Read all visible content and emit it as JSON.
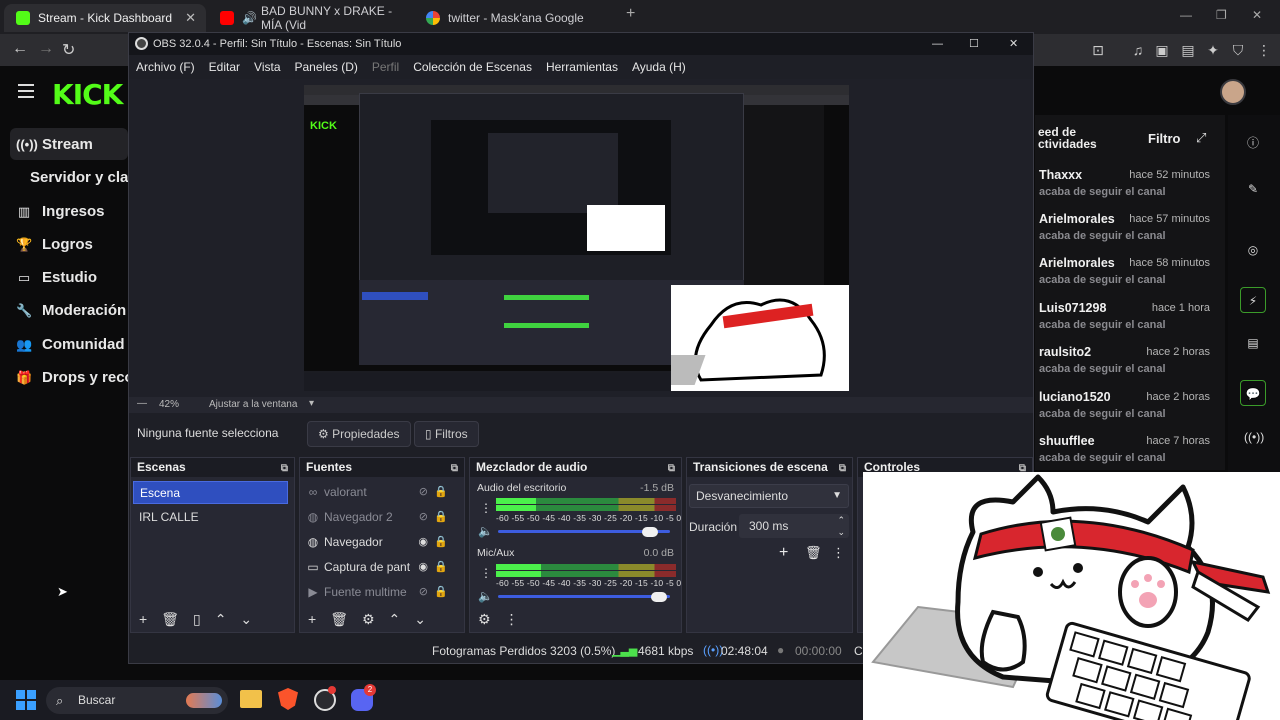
{
  "browser": {
    "tabs": [
      {
        "title": "Stream - Kick Dashboard"
      },
      {
        "title": "BAD BUNNY x DRAKE - MÍA (Vid"
      },
      {
        "title": "twitter - Mask'ana Google"
      }
    ]
  },
  "kick": {
    "logo": "KICK",
    "nav": [
      {
        "label": "Stream",
        "icon": "broadcast-icon"
      },
      {
        "label": "Servidor y clave",
        "icon": ""
      },
      {
        "label": "Ingresos",
        "icon": "chart-icon"
      },
      {
        "label": "Logros",
        "icon": "trophy-icon"
      },
      {
        "label": "Estudio",
        "icon": "monitor-icon"
      },
      {
        "label": "Moderación",
        "icon": "wrench-icon"
      },
      {
        "label": "Comunidad",
        "icon": "people-icon"
      },
      {
        "label": "Drops y recom",
        "icon": "gift-icon"
      }
    ],
    "feed": {
      "title_line1": "eed de",
      "title_line2": "ctividades",
      "filter": "Filtro",
      "items": [
        {
          "name": "Thaxxx",
          "time": "hace 52 minutos",
          "action": "acaba de seguir el canal"
        },
        {
          "name": "Arielmorales",
          "time": "hace 57 minutos",
          "action": "acaba de seguir el canal"
        },
        {
          "name": "Arielmorales",
          "time": "hace 58 minutos",
          "action": "acaba de seguir el canal"
        },
        {
          "name": "Luis071298",
          "time": "hace 1 hora",
          "action": "acaba de seguir el canal"
        },
        {
          "name": "raulsito2",
          "time": "hace 2 horas",
          "action": "acaba de seguir el canal"
        },
        {
          "name": "luciano1520",
          "time": "hace 2 horas",
          "action": "acaba de seguir el canal"
        },
        {
          "name": "shuufflee",
          "time": "hace 7 horas",
          "action": "acaba de seguir el canal"
        }
      ]
    }
  },
  "obs": {
    "title": "OBS 32.0.4 - Perfil: Sin Título - Escenas: Sin Título",
    "menu": [
      "Archivo (F)",
      "Editar",
      "Vista",
      "Paneles (D)",
      "Perfil",
      "Colección de Escenas",
      "Herramientas",
      "Ayuda (H)"
    ],
    "zoom": "42%",
    "fit": "Ajustar a la ventana",
    "no_source": "Ninguna fuente selecciona",
    "properties": "Propiedades",
    "filters": "Filtros",
    "docks": {
      "scenes": {
        "title": "Escenas",
        "items": [
          "Escena",
          "IRL CALLE"
        ]
      },
      "sources": {
        "title": "Fuentes",
        "items": [
          {
            "label": "valorant",
            "icon": "link-icon",
            "visible": false
          },
          {
            "label": "Navegador 2",
            "icon": "globe-icon",
            "visible": false
          },
          {
            "label": "Navegador",
            "icon": "globe-icon",
            "visible": true
          },
          {
            "label": "Captura de pant",
            "icon": "display-icon",
            "visible": true
          },
          {
            "label": "Fuente multime",
            "icon": "play-icon",
            "visible": false
          }
        ]
      },
      "mixer": {
        "title": "Mezclador de audio",
        "channels": [
          {
            "name": "Audio del escritorio",
            "db": "-1.5 dB",
            "level": 0.22,
            "volume": 0.93
          },
          {
            "name": "Mic/Aux",
            "db": "0.0 dB",
            "level": 0.25,
            "volume": 0.98
          }
        ],
        "scale": "-60 -55 -50 -45 -40 -35 -30 -25 -20 -15 -10  -5   0"
      },
      "transitions": {
        "title": "Transiciones de escena",
        "selected": "Desvanecimiento",
        "duration_label": "Duración",
        "duration": "300 ms"
      },
      "controls": {
        "title": "Controles"
      }
    },
    "status": {
      "dropped": "Fotogramas Perdidos 3203 (0.5%)",
      "bitrate": "4681 kbps",
      "live_time": "02:48:04",
      "rec_time": "00:00:00",
      "cpu": "CP"
    }
  },
  "taskbar": {
    "search": "Buscar",
    "discord_badge": "2"
  }
}
